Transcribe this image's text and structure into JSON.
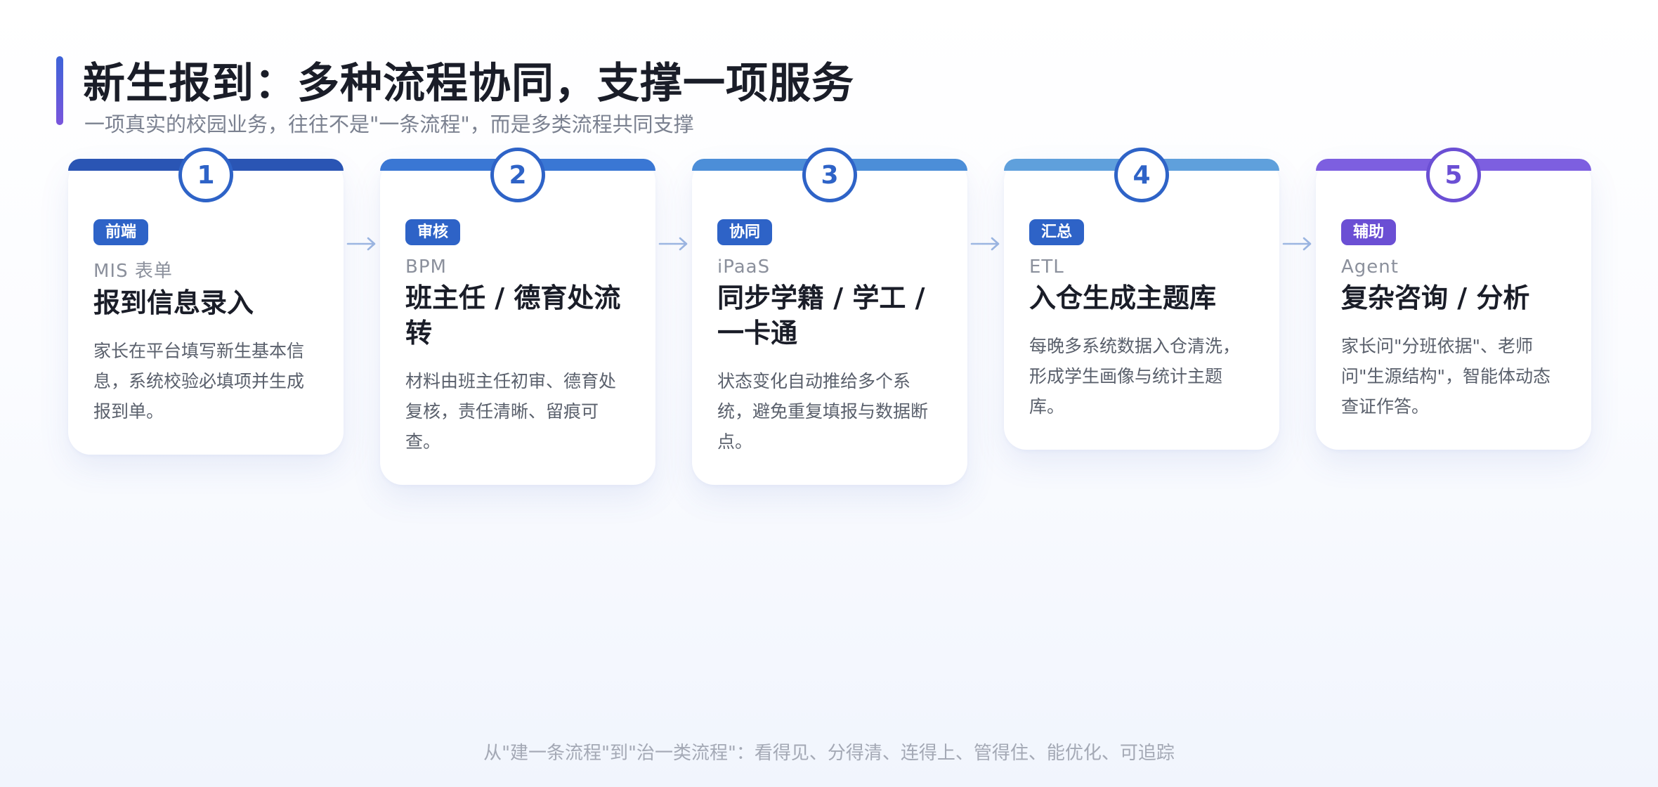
{
  "title": "新生报到：多种流程协同，支撑一项服务",
  "subtitle": "一项真实的校园业务，往往不是\"一条流程\"，而是多类流程共同支撑",
  "steps": [
    {
      "num": "1",
      "tag": "前端",
      "system": "MIS 表单",
      "title": "报到信息录入",
      "desc": "家长在平台填写新生基本信息，系统校验必填项并生成报到单。",
      "top_color": "#2a55b4",
      "accent": "#2e63c7",
      "tag_color": "#2e63c7"
    },
    {
      "num": "2",
      "tag": "审核",
      "system": "BPM",
      "title": "班主任 / 德育处流转",
      "desc": "材料由班主任初审、德育处复核，责任清晰、留痕可查。",
      "top_color": "#3a77d4",
      "accent": "#2e63c7",
      "tag_color": "#2e63c7"
    },
    {
      "num": "3",
      "tag": "协同",
      "system": "iPaaS",
      "title": "同步学籍 / 学工 / 一卡通",
      "desc": "状态变化自动推给多个系统，避免重复填报与数据断点。",
      "top_color": "#4c8ed8",
      "accent": "#2e63c7",
      "tag_color": "#2e63c7"
    },
    {
      "num": "4",
      "tag": "汇总",
      "system": "ETL",
      "title": "入仓生成主题库",
      "desc": "每晚多系统数据入仓清洗，形成学生画像与统计主题库。",
      "top_color": "#5fa0dc",
      "accent": "#2e63c7",
      "tag_color": "#2e63c7"
    },
    {
      "num": "5",
      "tag": "辅助",
      "system": "Agent",
      "title": "复杂咨询 / 分析",
      "desc": "家长问\"分班依据\"、老师问\"生源结构\"，智能体动态查证作答。",
      "top_color": "#7d5fe0",
      "accent": "#6b4fd4",
      "tag_color": "#6b4fd4"
    }
  ],
  "arrow_color": "#9db7e2",
  "footer": "从\"建一条流程\"到\"治一类流程\"：看得见、分得清、连得上、管得住、能优化、可追踪"
}
